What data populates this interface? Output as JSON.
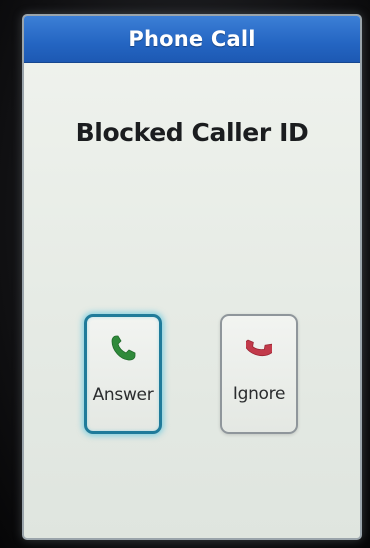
{
  "dialog": {
    "title": "Phone Call",
    "caller_id": "Blocked Caller ID"
  },
  "buttons": {
    "answer": {
      "label": "Answer",
      "icon": "phone-answer-icon",
      "color": "#2f8a3a"
    },
    "ignore": {
      "label": "Ignore",
      "icon": "phone-hangup-icon",
      "color": "#c23a4a"
    }
  },
  "colors": {
    "titlebar": "#2465c2",
    "focus_ring": "#1f7b9a"
  }
}
